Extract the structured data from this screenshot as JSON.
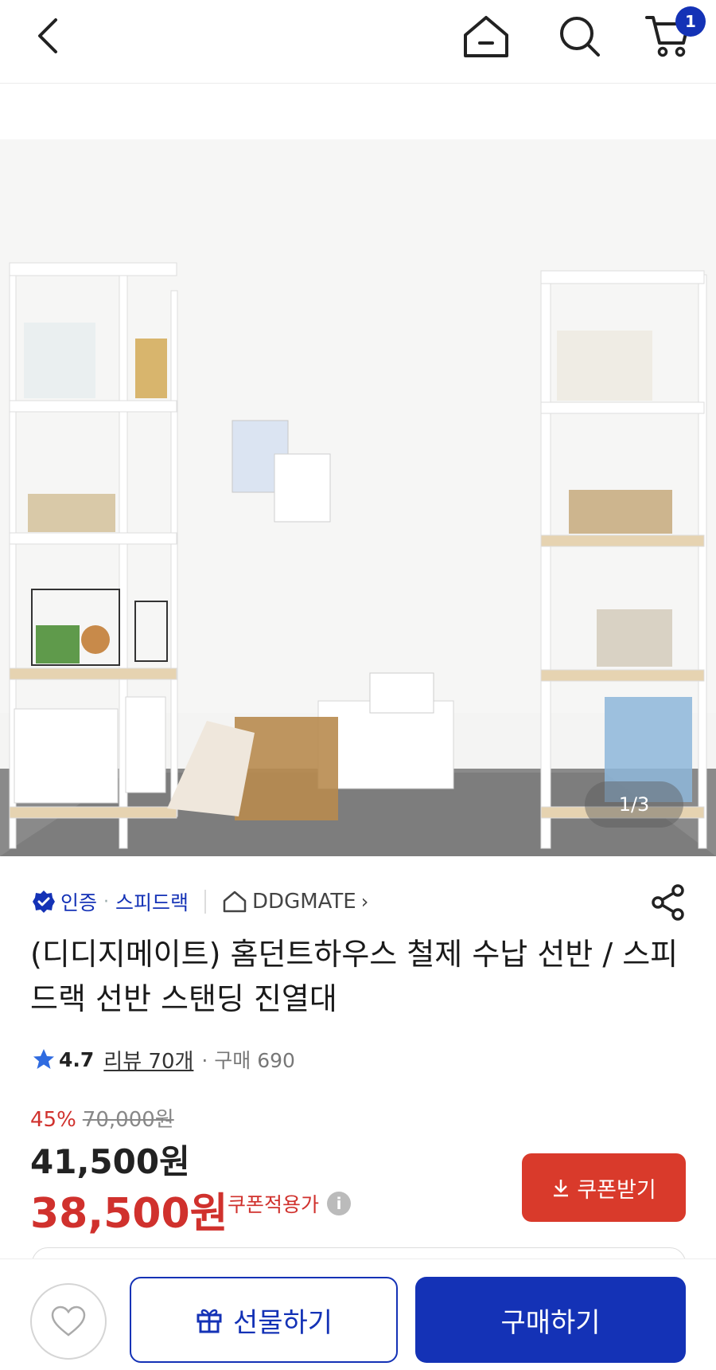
{
  "header": {
    "cart_count": "1"
  },
  "gallery": {
    "page_indicator": "1/3"
  },
  "seller": {
    "cert_label": "인증",
    "dot": "·",
    "brand": "스피드랙",
    "store": "DDGMATE",
    "store_arrow": "›"
  },
  "product": {
    "title": "(디디지메이트) 홈던트하우스 철제 수납 선반 / 스피드랙 선반 스탠딩 진열대",
    "rating": "4.7",
    "reviews": "리뷰 70개",
    "purchases": "· 구매 690"
  },
  "price": {
    "discount_rate": "45%",
    "original": "70,000원",
    "sale": "41,500원",
    "coupon_price": "38,500원",
    "coupon_label": "쿠폰적용가",
    "coupon_button": "쿠폰받기",
    "accent_color": "#d0312d"
  },
  "bottom": {
    "gift_label": "선물하기",
    "buy_label": "구매하기",
    "brand_color": "#1432b6"
  }
}
